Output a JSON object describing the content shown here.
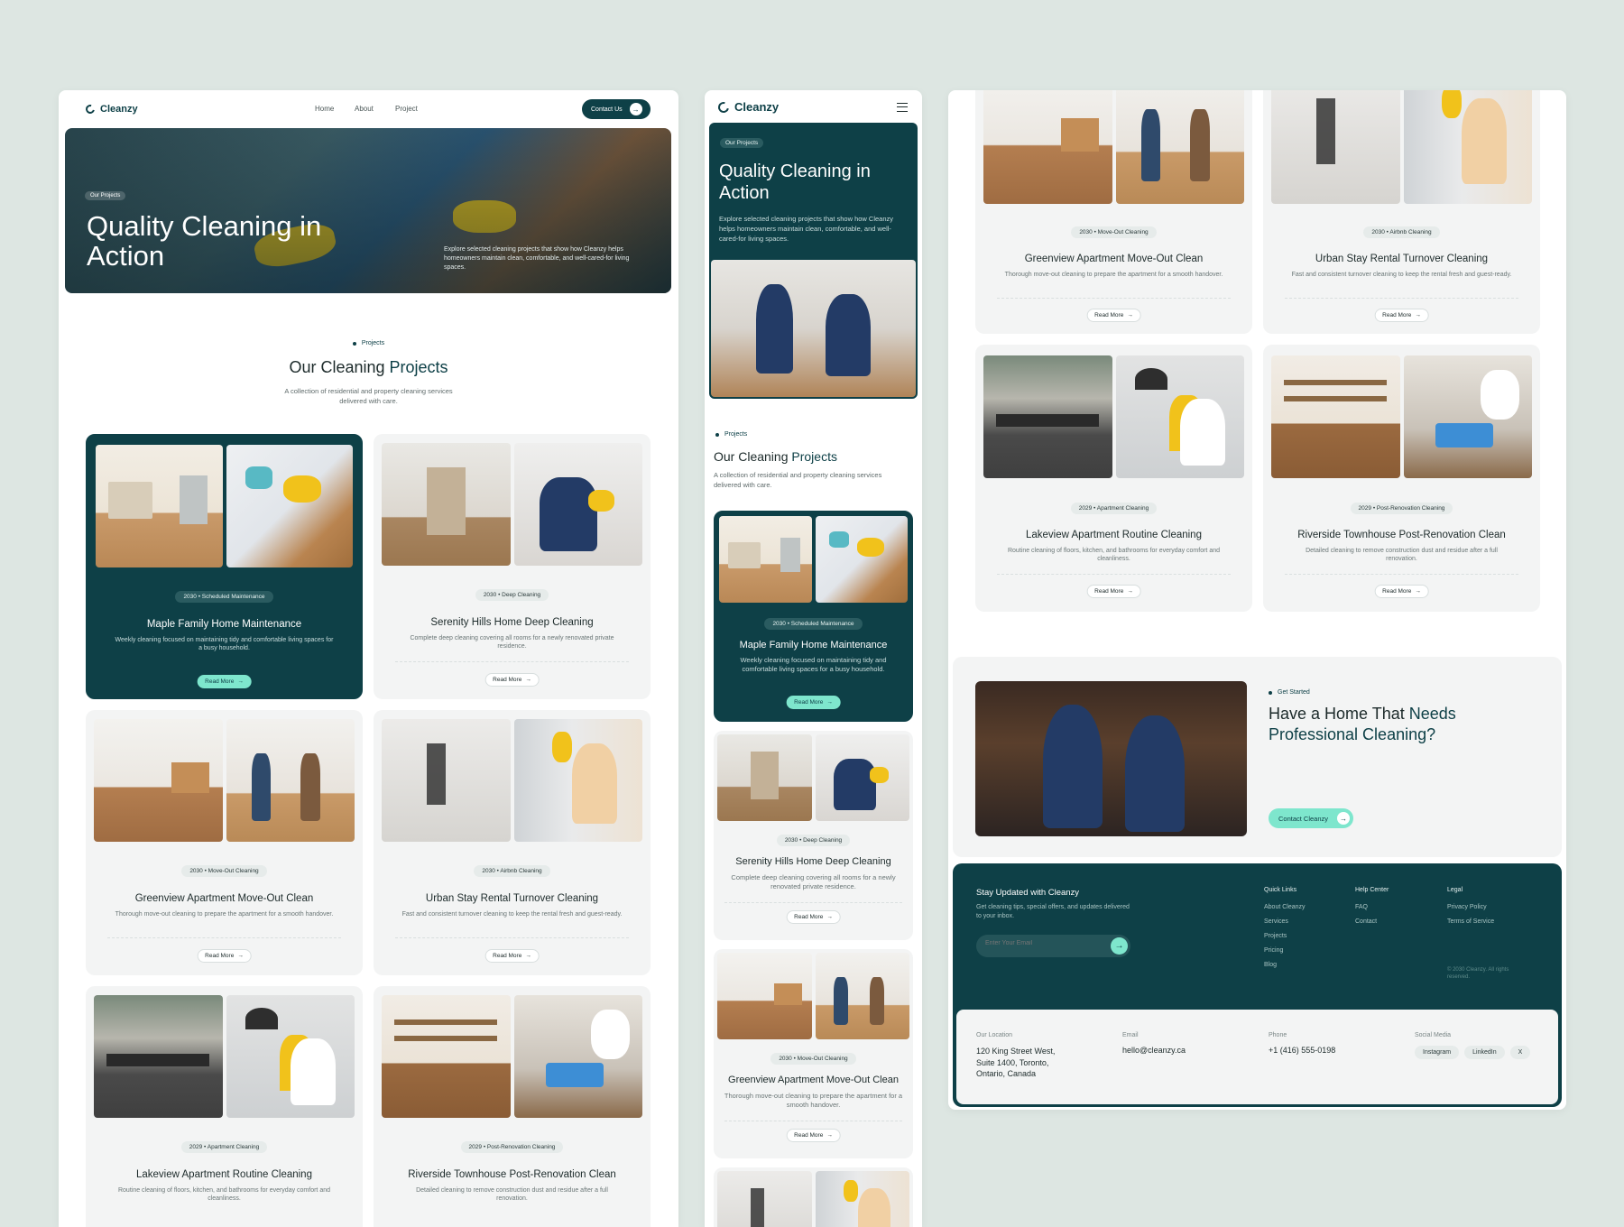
{
  "brand": {
    "name": "Cleanzy"
  },
  "nav": {
    "home": "Home",
    "about": "About",
    "project": "Project",
    "contact": "Contact Us"
  },
  "hero": {
    "tag": "Our Projects",
    "title": "Quality Cleaning in Action",
    "desc": "Explore selected cleaning projects that show how Cleanzy helps homeowners maintain clean, comfortable, and well-cared-for living spaces."
  },
  "projects_section": {
    "tag": "Projects",
    "title_plain": "Our Cleaning ",
    "title_accent": "Projects",
    "subtitle": "A collection of residential and property cleaning services delivered with care."
  },
  "read_more": "Read More",
  "projects": [
    {
      "year": "2030",
      "category": "Scheduled Maintenance",
      "title": "Maple Family Home Maintenance",
      "desc": "Weekly cleaning focused on maintaining tidy and comfortable living spaces for a busy household."
    },
    {
      "year": "2030",
      "category": "Deep Cleaning",
      "title": "Serenity Hills Home Deep Cleaning",
      "desc": "Complete deep cleaning covering all rooms for a newly renovated private residence."
    },
    {
      "year": "2030",
      "category": "Move-Out Cleaning",
      "title": "Greenview Apartment Move-Out Clean",
      "desc": "Thorough move-out cleaning to prepare the apartment for a smooth handover."
    },
    {
      "year": "2030",
      "category": "Airbnb Cleaning",
      "title": "Urban Stay Rental Turnover Cleaning",
      "desc": "Fast and consistent turnover cleaning to keep the rental fresh and guest-ready."
    },
    {
      "year": "2029",
      "category": "Apartment Cleaning",
      "title": "Lakeview Apartment Routine Cleaning",
      "desc": "Routine cleaning of floors, kitchen, and bathrooms for everyday comfort and cleanliness."
    },
    {
      "year": "2029",
      "category": "Post-Renovation Cleaning",
      "title": "Riverside Townhouse Post-Renovation Clean",
      "desc": "Detailed cleaning to remove construction dust and residue after a full renovation."
    }
  ],
  "cta": {
    "tag": "Get Started",
    "title_plain": "Have a Home That ",
    "title_accent": "Needs Professional Cleaning?",
    "button": "Contact Cleanzy"
  },
  "footer": {
    "newsletter_title": "Stay Updated with Cleanzy",
    "newsletter_desc": "Get cleaning tips, special offers, and updates delivered to your inbox.",
    "email_placeholder": "Enter Your Email",
    "quick_links": {
      "title": "Quick Links",
      "items": [
        "About Cleanzy",
        "Services",
        "Projects",
        "Pricing",
        "Blog"
      ]
    },
    "help_center": {
      "title": "Help Center",
      "items": [
        "FAQ",
        "Contact"
      ]
    },
    "legal": {
      "title": "Legal",
      "items": [
        "Privacy Policy",
        "Terms of Service"
      ]
    },
    "copyright": "© 2030 Cleanzy. All rights reserved.",
    "location_label": "Our Location",
    "location": "120 King Street West, Suite 1400, Toronto, Ontario, Canada",
    "email_label": "Email",
    "email": "hello@cleanzy.ca",
    "phone_label": "Phone",
    "phone": "+1 (416) 555-0198",
    "social_label": "Social Media",
    "social": [
      "Instagram",
      "LinkedIn",
      "X"
    ]
  },
  "colors": {
    "primary": "#0e4047",
    "accent": "#7ee6cd",
    "background": "#dde6e2"
  }
}
